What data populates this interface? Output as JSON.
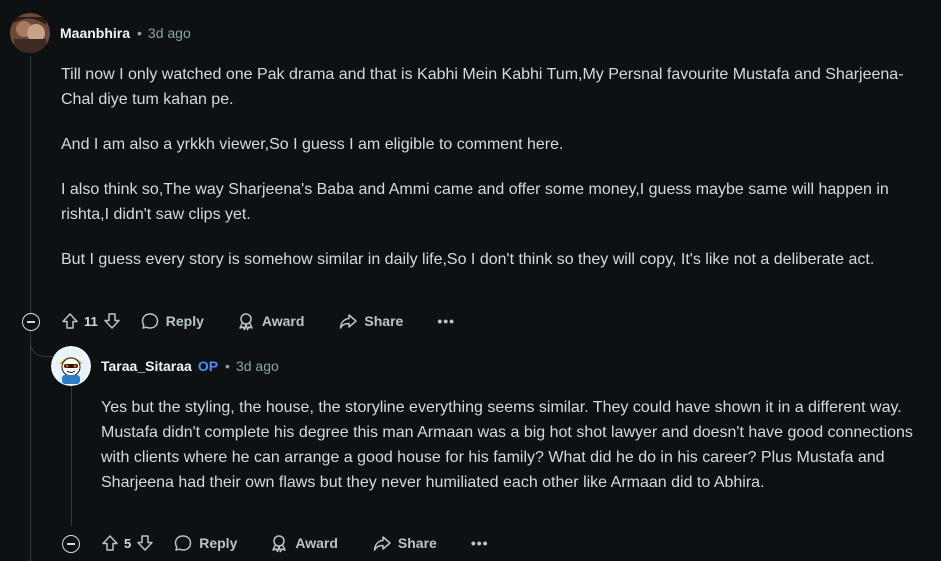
{
  "comments": [
    {
      "author": "Maanbhira",
      "op_badge": "",
      "separator": "•",
      "time_ago": "3d ago",
      "paragraphs": [
        "Till now I only watched one Pak drama and that is Kabhi Mein Kabhi Tum,My Persnal favourite Mustafa and Sharjeena-Chal diye tum kahan pe.",
        "And I am also a yrkkh viewer,So I guess I am eligible to comment here.",
        "I also think so,The way Sharjeena's Baba and Ammi came and offer some money,I guess maybe same will happen in rishta,I didn't saw clips yet.",
        "But I guess every story is somehow similar in daily life,So I don't think so they will copy, It's like not a deliberate act."
      ],
      "score": "11",
      "reply_label": "Reply",
      "award_label": "Award",
      "share_label": "Share",
      "more_label": "•••"
    },
    {
      "author": "Taraa_Sitaraa",
      "op_badge": "OP",
      "separator": "•",
      "time_ago": "3d ago",
      "paragraphs": [
        "Yes but the styling, the house, the storyline everything seems similar. They could have shown it in a different way. Mustafa didn't complete his degree this man Armaan was a big hot shot lawyer and doesn't have good connections with clients where he can arrange a good house for his family? What did he do in his career? Plus Mustafa and Sharjeena had their own flaws but they never humiliated each other like Armaan did to Abhira."
      ],
      "score": "5",
      "reply_label": "Reply",
      "award_label": "Award",
      "share_label": "Share",
      "more_label": "•••"
    }
  ],
  "icons": {
    "upvote": "arrow-up-icon",
    "downvote": "arrow-down-icon",
    "reply": "speech-bubble-icon",
    "award": "award-ribbon-icon",
    "share": "share-arrow-icon",
    "collapse": "collapse-minus-icon"
  },
  "colors": {
    "background": "#0e1113",
    "text": "#d7dadc",
    "muted": "#8ba2ad",
    "op_badge": "#4f8ef7"
  }
}
